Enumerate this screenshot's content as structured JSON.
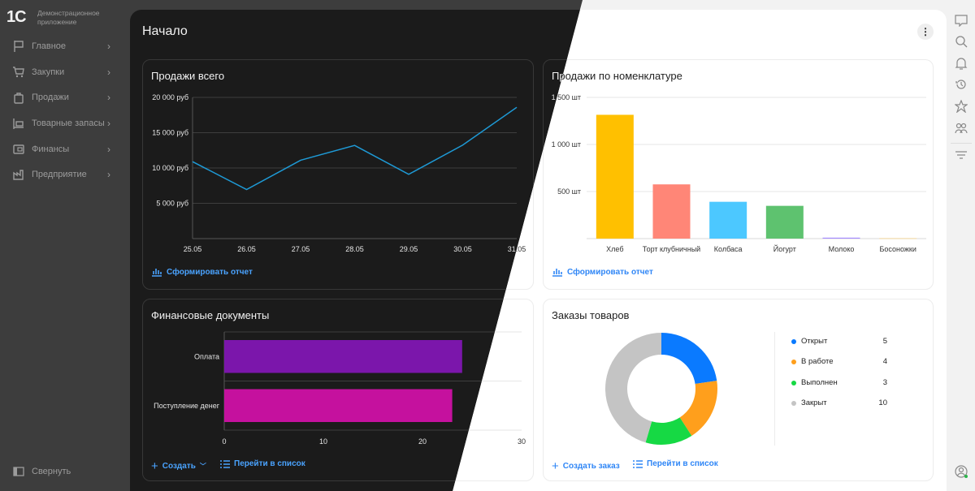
{
  "logo": {
    "mark": "1С",
    "text": "Демонстрационное приложение"
  },
  "sidebar": {
    "items": [
      {
        "label": "Главное",
        "icon": "flag-icon"
      },
      {
        "label": "Закупки",
        "icon": "cart-icon"
      },
      {
        "label": "Продажи",
        "icon": "bag-icon"
      },
      {
        "label": "Товарные запасы",
        "icon": "warehouse-icon"
      },
      {
        "label": "Финансы",
        "icon": "wallet-icon"
      },
      {
        "label": "Предприятие",
        "icon": "factory-icon"
      }
    ],
    "collapse_label": "Свернуть"
  },
  "header": {
    "title": "Начало",
    "more": "⋮"
  },
  "rightbar": {
    "icons": [
      "chat-icon",
      "search-icon",
      "bell-icon",
      "history-icon",
      "star-icon",
      "users-icon",
      "filter-icon",
      "account-icon"
    ]
  },
  "cards": {
    "sales_total": {
      "title": "Продажи всего",
      "action": "Сформировать отчет"
    },
    "sales_items": {
      "title": "Продажи по номенклатуре",
      "action": "Сформировать отчет"
    },
    "fin_docs": {
      "title": "Финансовые документы",
      "create": "Создать",
      "list": "Перейти в список"
    },
    "orders": {
      "title": "Заказы товаров",
      "create": "Создать заказ",
      "list": "Перейти в список"
    }
  },
  "chart_data": [
    {
      "type": "line",
      "title": "Продажи всего",
      "categories": [
        "25.05",
        "26.05",
        "27.05",
        "28.05",
        "29.05",
        "30.05",
        "31.05"
      ],
      "values": [
        10900,
        6950,
        11100,
        13200,
        9100,
        13250,
        18600
      ],
      "yticks": [
        {
          "v": 5000,
          "label": "5 000 руб"
        },
        {
          "v": 10000,
          "label": "10 000 руб"
        },
        {
          "v": 15000,
          "label": "15 000 руб"
        },
        {
          "v": 20000,
          "label": "20 000 руб"
        }
      ],
      "ylim": [
        0,
        20000
      ],
      "color": "#1e9ad6",
      "grid": true
    },
    {
      "type": "bar",
      "title": "Продажи по номенклатуре",
      "categories": [
        "Хлеб",
        "Торт клубничный",
        "Колбаса",
        "Йогурт",
        "Молоко",
        "Босоножки"
      ],
      "values": [
        1315,
        576,
        391,
        348,
        10,
        5
      ],
      "colors": [
        "#ffc000",
        "#ff8677",
        "#4cc8ff",
        "#5ec26f",
        "#a58bff",
        "#f0d49a"
      ],
      "yticks": [
        {
          "v": 500,
          "label": "500 шт"
        },
        {
          "v": 1000,
          "label": "1 000 шт"
        },
        {
          "v": 1500,
          "label": "1 500 шт"
        }
      ],
      "ylim": [
        0,
        1500
      ],
      "grid": true
    },
    {
      "type": "bar",
      "orientation": "horizontal",
      "title": "Финансовые документы",
      "categories": [
        "Оплата",
        "Поступление денег"
      ],
      "values": [
        24,
        23
      ],
      "colors": [
        "#7b16ab",
        "#c5119e"
      ],
      "xticks": [
        "0",
        "10",
        "20",
        "30"
      ],
      "xlim": [
        0,
        30
      ],
      "grid": true
    },
    {
      "type": "pie",
      "donut": true,
      "title": "Заказы товаров",
      "categories": [
        "Открыт",
        "В работе",
        "Выполнен",
        "Закрыт"
      ],
      "values": [
        5,
        4,
        3,
        10
      ],
      "colors": [
        "#0a7aff",
        "#ff9f1c",
        "#16d944",
        "#c4c4c4"
      ],
      "legend": "right"
    }
  ]
}
